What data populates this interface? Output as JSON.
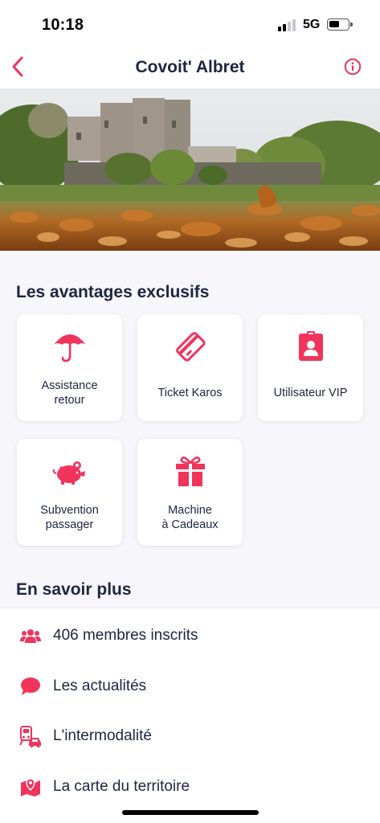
{
  "status_bar": {
    "time": "10:18",
    "network": "5G",
    "battery_level": 0.55
  },
  "nav": {
    "title": "Covoit' Albret",
    "back_icon": "chevron-left-icon",
    "info_icon": "info-circle-icon"
  },
  "colors": {
    "accent": "#f0345c",
    "text": "#1d2540",
    "background": "#f7f7fb"
  },
  "advantages": {
    "title": "Les avantages exclusifs",
    "cards": [
      {
        "label": "Assistance\nretour",
        "icon": "umbrella-icon"
      },
      {
        "label": "Ticket Karos",
        "icon": "ticket-icon"
      },
      {
        "label": "Utilisateur VIP",
        "icon": "vip-badge-icon"
      },
      {
        "label": "Subvention\npassager",
        "icon": "piggy-bank-icon"
      },
      {
        "label": "Machine\nà Cadeaux",
        "icon": "gift-icon"
      }
    ]
  },
  "learn_more": {
    "title": "En savoir plus",
    "items": [
      {
        "label": "406 membres inscrits",
        "icon": "users-icon"
      },
      {
        "label": "Les actualités",
        "icon": "chat-bubble-icon"
      },
      {
        "label": "L'intermodalité",
        "icon": "train-car-icon"
      },
      {
        "label": "La carte du territoire",
        "icon": "map-pin-icon"
      }
    ]
  }
}
